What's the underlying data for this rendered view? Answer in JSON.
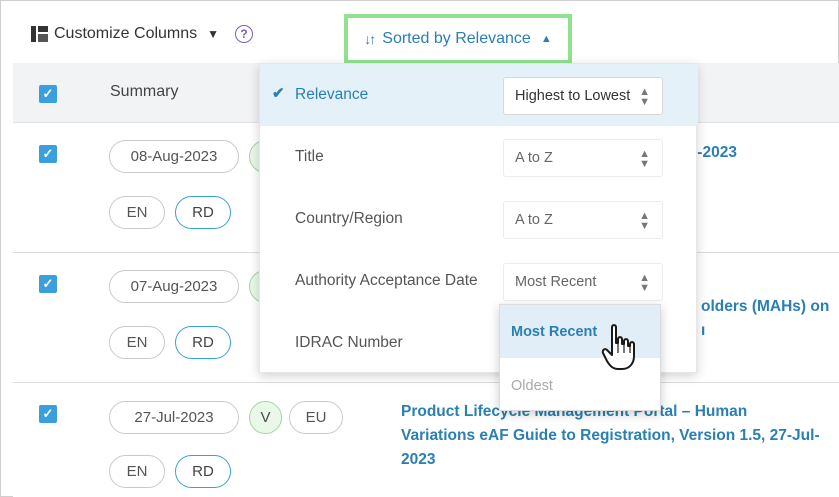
{
  "toolbar": {
    "customize_label": "Customize Columns",
    "help_glyph": "?",
    "sort_label": "Sorted by Relevance"
  },
  "table": {
    "summary_header": "Summary",
    "rows": [
      {
        "date": "08-Aug-2023",
        "tags": [
          "EN",
          "RD"
        ],
        "title_fragment": "ı-2023"
      },
      {
        "date": "07-Aug-2023",
        "tags": [
          "EN",
          "RD"
        ],
        "title_fragment": "olders (MAHs) on",
        "title_fragment2": "ı"
      },
      {
        "date": "27-Jul-2023",
        "badges": [
          "V",
          "EU"
        ],
        "tags": [
          "EN",
          "RD"
        ],
        "title": "Product Lifecycle Management Portal – Human Variations eAF Guide to Registration, Version 1.5, 27-Jul-2023"
      }
    ]
  },
  "sort_panel": {
    "rows": [
      {
        "label": "Relevance",
        "value": "Highest to Lowest",
        "active": true
      },
      {
        "label": "Title",
        "value": "A to Z"
      },
      {
        "label": "Country/Region",
        "value": "A to Z"
      },
      {
        "label": "Authority Acceptance Date",
        "value": "Most Recent"
      },
      {
        "label": "IDRAC Number",
        "value": ""
      }
    ],
    "open_dropdown": {
      "options": [
        "Most Recent",
        "Oldest"
      ],
      "highlighted": "Most Recent"
    }
  },
  "colors": {
    "accent": "#2a7fb3",
    "checkbox": "#3aa0dd",
    "highlight_border": "#8fe28f"
  },
  "icons": [
    "columns-icon",
    "chevron-down-icon",
    "help-icon",
    "sort-icon",
    "chevron-up-icon",
    "checkbox-icon",
    "checkmark-icon",
    "select-arrows-icon",
    "hand-cursor-icon"
  ]
}
